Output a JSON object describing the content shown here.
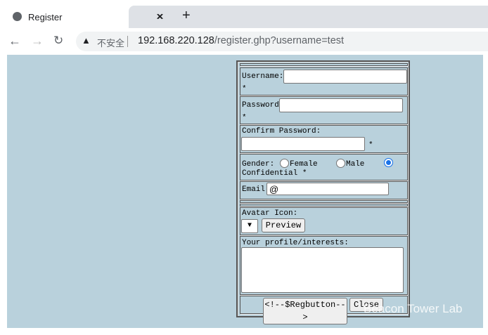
{
  "browser": {
    "tab_title": "Register",
    "close": "×",
    "new_tab": "+",
    "security": "不安全",
    "url_host": "192.168.220.128",
    "url_path": "/register.ghp?username=test"
  },
  "form": {
    "username_label": "Username:",
    "required": "*",
    "password_label": "Password:",
    "confirm_label": "Confirm Password:",
    "gender_label": "Gender:",
    "female": "Female",
    "male": "Male",
    "confidential": "Confidential *",
    "email_label": "Email:",
    "email_value": "@",
    "avatar_label": "Avatar Icon:",
    "preview": "Preview",
    "profile_label": "Your profile/interests:",
    "register": "<!--$Regbutton-->",
    "close": "Close"
  },
  "watermark": "Beacon Tower Lab",
  "colors": {
    "page_bg": "#b9d1dc",
    "radio_checked": "#1a73e8"
  }
}
